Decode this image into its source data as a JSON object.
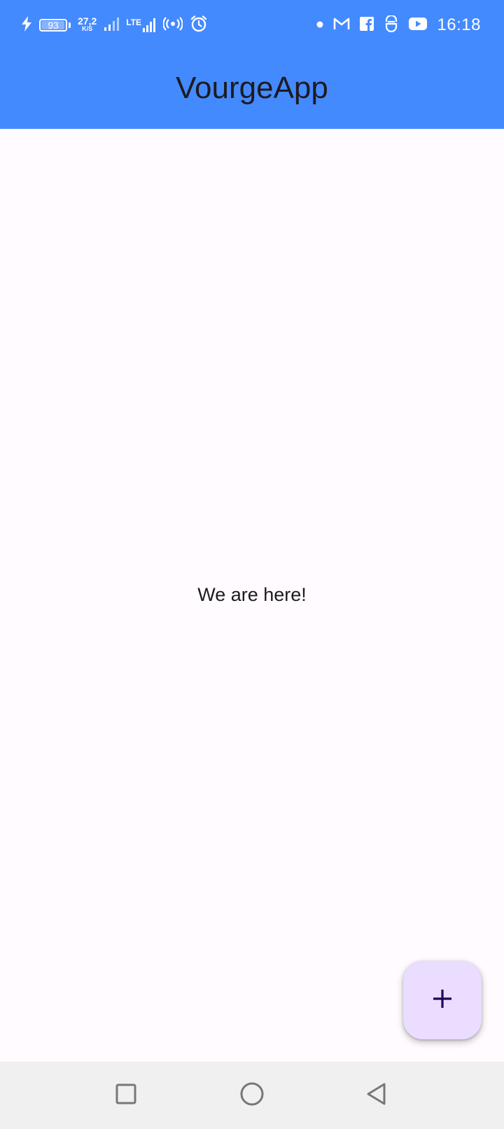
{
  "status_bar": {
    "battery_level": "93",
    "net_speed_value": "27,2",
    "net_speed_unit": "K/S",
    "network_type": "LTE",
    "time": "16:18",
    "icons": [
      "charging-icon",
      "battery-icon",
      "signal-icon",
      "lte-signal-icon",
      "hotspot-icon",
      "alarm-icon",
      "notification-dot-icon",
      "gmail-icon",
      "facebook-icon",
      "app-icon",
      "youtube-icon"
    ]
  },
  "app_bar": {
    "title": "VourgeApp",
    "color": "#448aff"
  },
  "main": {
    "message": "We are here!"
  },
  "fab": {
    "icon": "add-icon",
    "color": "#eaddff",
    "icon_color": "#21005d"
  },
  "nav_bar": {
    "buttons": [
      "recents-button",
      "home-button",
      "back-button"
    ]
  }
}
